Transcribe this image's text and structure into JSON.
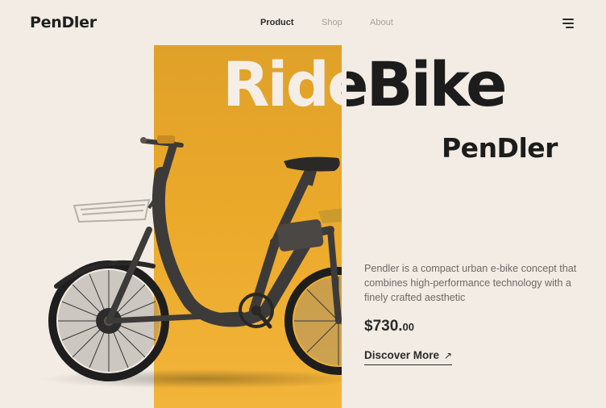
{
  "brand": {
    "logo": "PenDler"
  },
  "nav": {
    "items": [
      "Product",
      "Shop",
      "About"
    ],
    "active": "Product"
  },
  "hero": {
    "title": "RideBike",
    "subtitle": "PenDler"
  },
  "product": {
    "description": "Pendler is a compact urban e-bike concept that combines high-performance technology with a finely crafted aesthetic",
    "price_main": "$730.",
    "price_cents": "00"
  },
  "cta": {
    "label": "Discover More",
    "arrow": "↗"
  },
  "icons": {
    "menu": "menu-icon",
    "arrow": "arrow-up-right-icon",
    "product": "e-bike-image"
  },
  "colors": {
    "background": "#f2ece4",
    "accent": "#eba92a",
    "text": "#1c1c1c",
    "muted": "#a8a29b"
  }
}
